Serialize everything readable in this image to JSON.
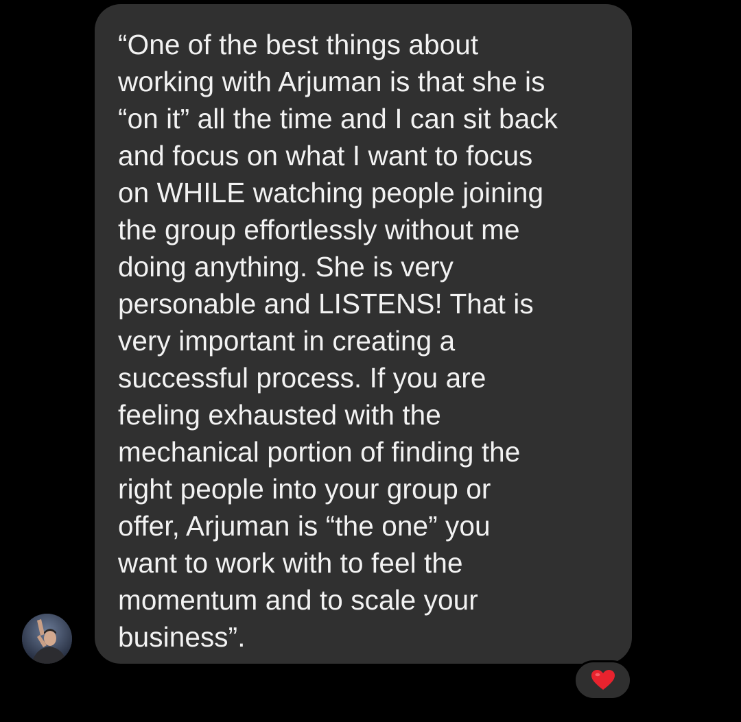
{
  "message": {
    "lines": [
      "“One of the best things about",
      "working with Arjuman is that she is",
      "“on it” all the time and I can sit back",
      "and focus on what I want to focus",
      "on WHILE watching people joining",
      "the group effortlessly without me",
      "doing anything. She is very",
      "personable and LISTENS! That is",
      "very important in creating a",
      "successful process. If you are",
      "feeling exhausted with the",
      "mechanical portion of finding the",
      "right people into your group or",
      "offer, Arjuman is “the one” you",
      "want to work with to feel the",
      "momentum and to scale your",
      "business”."
    ],
    "reaction": {
      "icon": "red-heart-icon",
      "color": "#e8232e"
    }
  },
  "sender": {
    "avatar_icon": "profile-photo"
  },
  "colors": {
    "background": "#000000",
    "bubble": "#303030",
    "text": "#f2f2f2"
  }
}
